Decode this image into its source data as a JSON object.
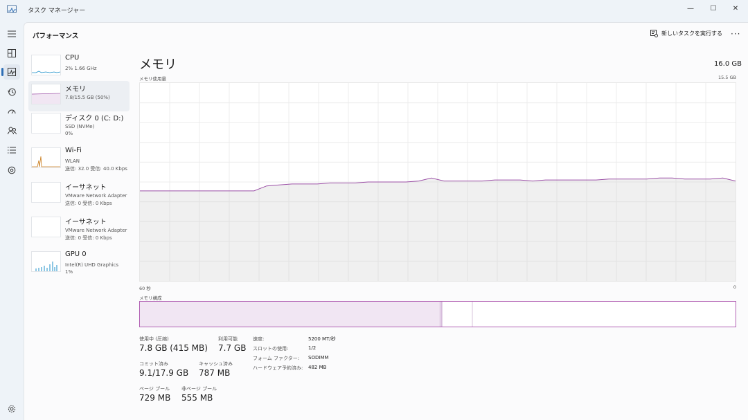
{
  "window": {
    "title": "タスク マネージャー",
    "minimize": "—",
    "maximize": "☐",
    "close": "✕"
  },
  "rail": {
    "items": [
      {
        "name": "menu-icon"
      },
      {
        "name": "processes-icon"
      },
      {
        "name": "performance-icon",
        "active": true
      },
      {
        "name": "app-history-icon"
      },
      {
        "name": "startup-apps-icon"
      },
      {
        "name": "users-icon"
      },
      {
        "name": "details-icon"
      },
      {
        "name": "services-icon"
      }
    ],
    "settings": "settings-icon"
  },
  "header": {
    "title": "パフォーマンス",
    "run_task": "新しいタスクを実行する",
    "more": "···"
  },
  "resources": [
    {
      "name": "CPU",
      "lines": [
        "2% 1.66 GHz"
      ],
      "color": "#1b8fc9"
    },
    {
      "name": "メモリ",
      "lines": [
        "7.8/15.5 GB (50%)"
      ],
      "color": "#9b4fa6",
      "selected": true
    },
    {
      "name": "ディスク 0 (C: D:)",
      "lines": [
        "SSD (NVMe)",
        "0%"
      ],
      "color": "#4c9c3f"
    },
    {
      "name": "Wi-Fi",
      "lines": [
        "WLAN",
        "送信: 32.0 受信: 40.0 Kbps"
      ],
      "color": "#c97b1b"
    },
    {
      "name": "イーサネット",
      "lines": [
        "VMware Network Adapter",
        "送信: 0 受信: 0 Kbps"
      ],
      "color": "#c97b1b"
    },
    {
      "name": "イーサネット",
      "lines": [
        "VMware Network Adapter",
        "送信: 0 受信: 0 Kbps"
      ],
      "color": "#c97b1b"
    },
    {
      "name": "GPU 0",
      "lines": [
        "Intel(R) UHD Graphics",
        "1%"
      ],
      "color": "#1b8fc9"
    }
  ],
  "memory": {
    "title": "メモリ",
    "total": "16.0 GB",
    "usage_label": "メモリ使用量",
    "usage_max": "15.5 GB",
    "time_left": "60 秒",
    "time_right": "0",
    "composition_label": "メモリ構成",
    "accent": "#9b4fa6",
    "usage_series": [
      0.455,
      0.455,
      0.455,
      0.455,
      0.455,
      0.455,
      0.455,
      0.455,
      0.455,
      0.455,
      0.48,
      0.485,
      0.49,
      0.49,
      0.49,
      0.495,
      0.495,
      0.495,
      0.5,
      0.5,
      0.5,
      0.5,
      0.505,
      0.52,
      0.505,
      0.505,
      0.505,
      0.505,
      0.51,
      0.51,
      0.51,
      0.505,
      0.51,
      0.51,
      0.51,
      0.51,
      0.51,
      0.515,
      0.515,
      0.515,
      0.515,
      0.52,
      0.52,
      0.515,
      0.515,
      0.515,
      0.52,
      0.505
    ],
    "composition": {
      "in_use": 0.503,
      "modified": 0.004,
      "standby": 0.05
    },
    "stats": [
      {
        "label": "使用中 (圧縮)",
        "value": "7.8 GB (415 MB)"
      },
      {
        "label": "利用可能",
        "value": "7.7 GB"
      },
      {
        "label": "コミット済み",
        "value": "9.1/17.9 GB"
      },
      {
        "label": "キャッシュ済み",
        "value": "787 MB"
      },
      {
        "label": "ページ プール",
        "value": "729 MB"
      },
      {
        "label": "非ページ プール",
        "value": "555 MB"
      }
    ],
    "props": [
      {
        "label": "速度:",
        "value": "5200 MT/秒"
      },
      {
        "label": "スロットの使用:",
        "value": "1/2"
      },
      {
        "label": "フォーム ファクター:",
        "value": "SODIMM"
      },
      {
        "label": "ハードウェア予約済み:",
        "value": "482 MB"
      }
    ]
  }
}
